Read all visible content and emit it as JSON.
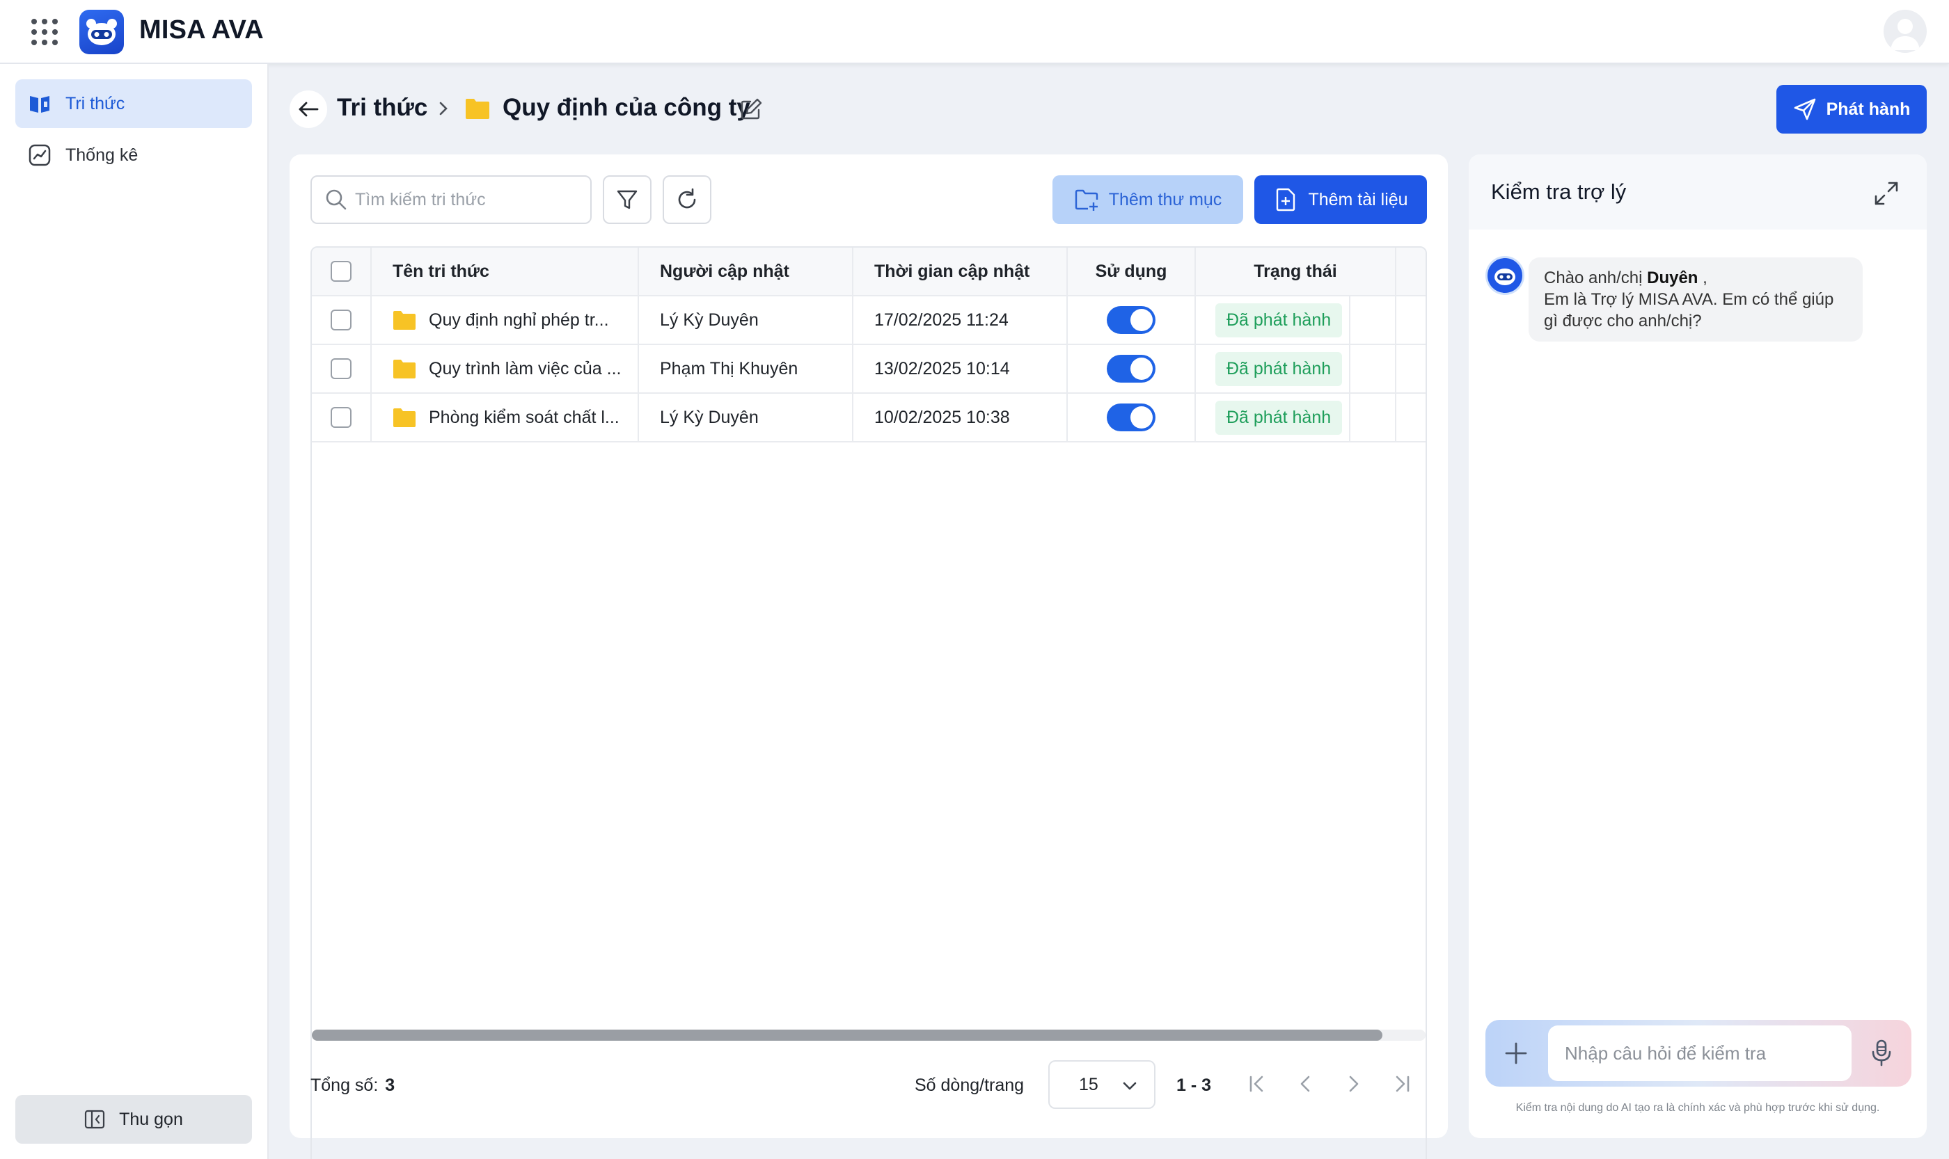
{
  "app": {
    "name": "MISA AVA"
  },
  "icons": {
    "apps": "grid-dots-icon",
    "logo": "misa-ava-robot-logo",
    "avatar": "user-avatar-icon"
  },
  "colors": {
    "primary": "#1f57e6",
    "primary_light": "#b7d2f9",
    "success": "#1e9e5a",
    "folder": "#f7c325"
  },
  "sidebar": {
    "items": [
      {
        "label": "Tri thức",
        "icon": "book-icon",
        "active": true
      },
      {
        "label": "Thống kê",
        "icon": "chart-icon",
        "active": false
      }
    ],
    "collapse_label": "Thu gọn"
  },
  "header": {
    "breadcrumb_root": "Tri thức",
    "current_folder": "Quy định của công ty",
    "publish_label": "Phát hành"
  },
  "toolbar": {
    "search_placeholder": "Tìm kiếm tri thức",
    "add_folder_label": "Thêm thư mục",
    "add_document_label": "Thêm tài liệu"
  },
  "table": {
    "columns": [
      "Tên tri thức",
      "Người cập nhật",
      "Thời gian cập nhật",
      "Sử dụng",
      "Trạng thái"
    ],
    "rows": [
      {
        "name": "Quy định nghỉ phép tr...",
        "updated_by": "Lý Kỳ Duyên",
        "updated_at": "17/02/2025 11:24",
        "in_use": true,
        "status": "Đã phát hành"
      },
      {
        "name": "Quy trình làm việc của ...",
        "updated_by": "Phạm Thị Khuyên",
        "updated_at": "13/02/2025 10:14",
        "in_use": true,
        "status": "Đã phát hành"
      },
      {
        "name": "Phòng kiểm soát chất l...",
        "updated_by": "Lý Kỳ Duyên",
        "updated_at": "10/02/2025 10:38",
        "in_use": true,
        "status": "Đã phát hành"
      }
    ]
  },
  "footer": {
    "total_label": "Tổng số:",
    "total_value": "3",
    "rows_per_page_label": "Số dòng/trang",
    "rows_per_page_value": "15",
    "range": "1 - 3"
  },
  "assistant": {
    "title": "Kiểm tra trợ lý",
    "greeting_prefix": "Chào anh/chị",
    "greeting_name": "Duyên",
    "greeting_suffix": ",",
    "greeting_body": "Em là Trợ lý MISA AVA. Em có thể giúp gì được cho anh/chị?",
    "input_placeholder": "Nhập câu hỏi để kiểm tra",
    "disclaimer": "Kiểm tra nội dung do AI tạo ra là chính xác và phù hợp trước khi sử dụng."
  }
}
